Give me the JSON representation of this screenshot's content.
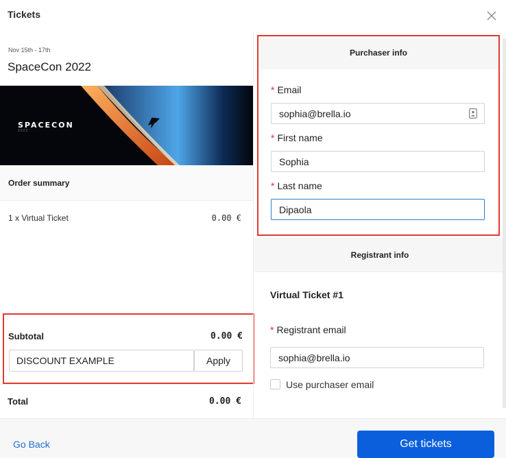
{
  "header": {
    "title": "Tickets",
    "close_icon": "close-icon"
  },
  "event": {
    "date": "Nov 15th - 17th",
    "title": "SpaceCon 2022",
    "banner_logo": "SPACECON",
    "banner_logo_sub": "2022"
  },
  "order_summary": {
    "heading": "Order summary",
    "items": [
      {
        "label": "1 x Virtual Ticket",
        "price": "0.00 €"
      }
    ],
    "subtotal_label": "Subtotal",
    "subtotal_value": "0.00 €",
    "discount_value": "DISCOUNT EXAMPLE",
    "apply_label": "Apply",
    "total_label": "Total",
    "total_value": "0.00 €"
  },
  "purchaser": {
    "heading": "Purchaser info",
    "email_label": "Email",
    "email_value": "sophia@brella.io",
    "first_name_label": "First name",
    "first_name_value": "Sophia",
    "last_name_label": "Last name",
    "last_name_value": "Dipaola",
    "required_mark": "*"
  },
  "registrant": {
    "heading": "Registrant info",
    "ticket_title": "Virtual Ticket #1",
    "email_label": "Registrant email",
    "email_value": "sophia@brella.io",
    "use_purchaser_label": "Use purchaser email",
    "use_purchaser_checked": false
  },
  "footer": {
    "go_back_label": "Go Back",
    "get_tickets_label": "Get tickets"
  },
  "colors": {
    "primary": "#0b5fdc",
    "link": "#1e6ed6",
    "highlight": "#e03a2f",
    "required": "#d32f2f",
    "focus": "#2a7bd0"
  }
}
